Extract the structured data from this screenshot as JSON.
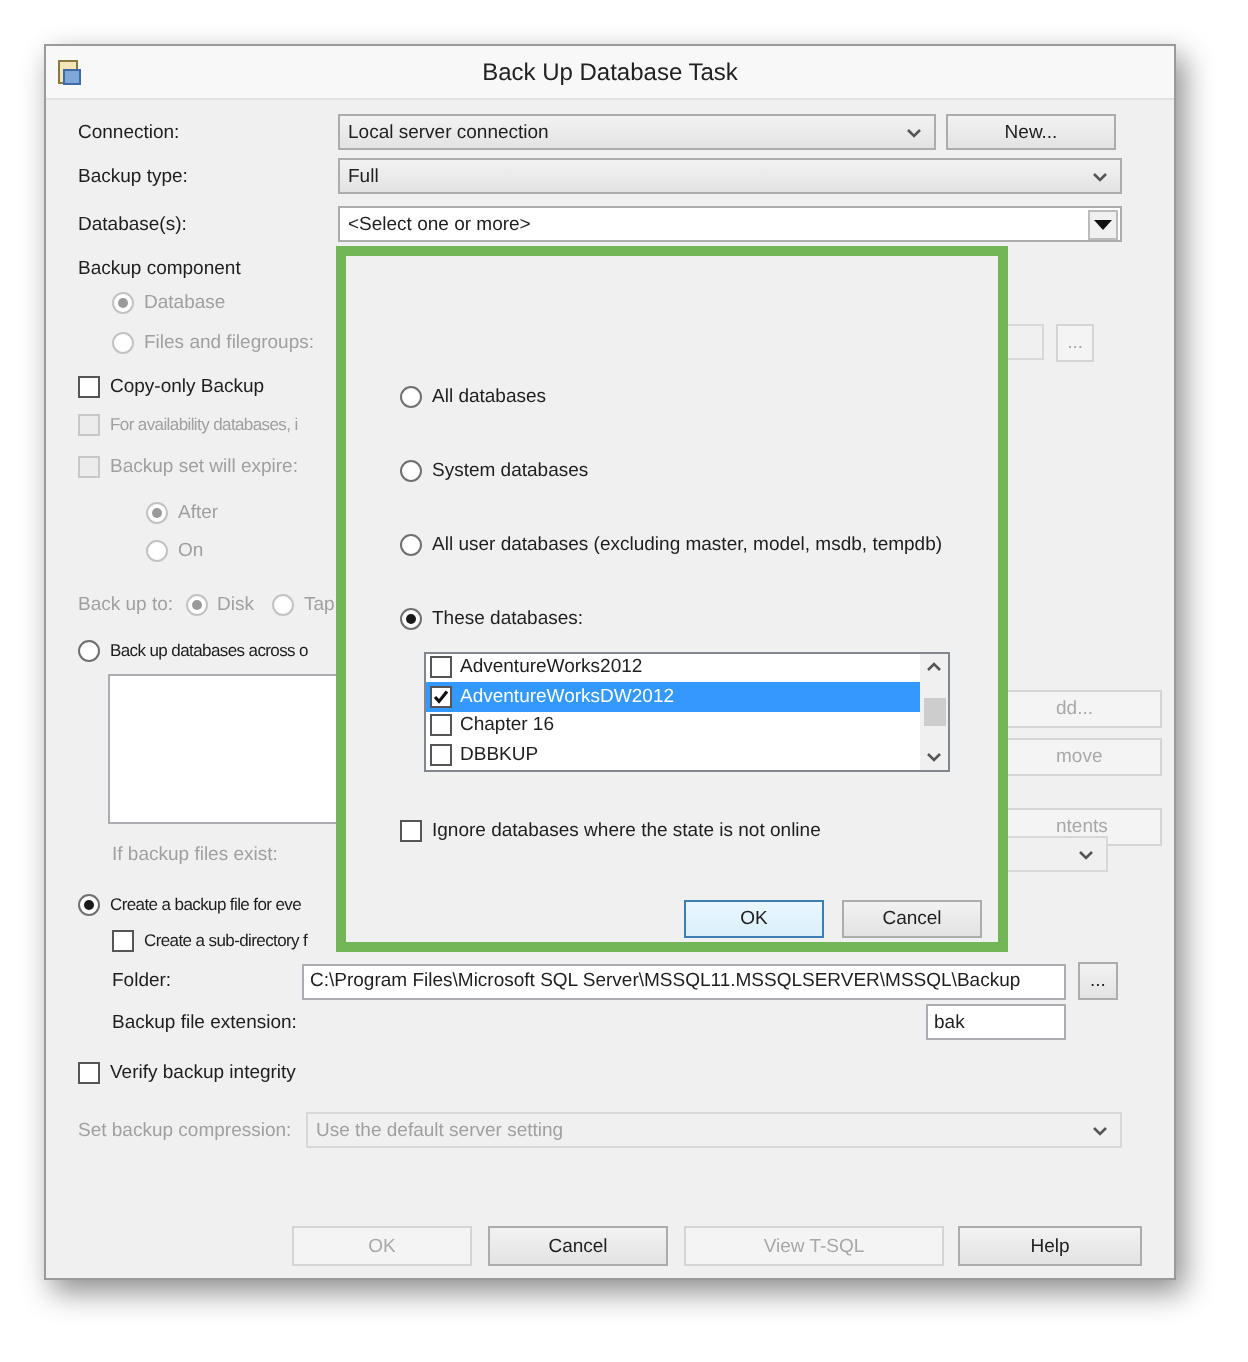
{
  "window": {
    "title": "Back Up Database Task"
  },
  "connection": {
    "label": "Connection:",
    "value": "Local server connection",
    "button": "New..."
  },
  "backup_type": {
    "label": "Backup type:",
    "value": "Full"
  },
  "databases": {
    "label": "Database(s):",
    "value": "<Select one or more>"
  },
  "backup_component": {
    "label": "Backup component",
    "browse_button": "...",
    "options": [
      {
        "label": "Database",
        "selected": true,
        "disabled": true
      },
      {
        "label": "Files and filegroups:",
        "selected": false,
        "disabled": true
      }
    ]
  },
  "options_top": [
    {
      "label": "Copy-only Backup",
      "checked": false,
      "disabled": false
    },
    {
      "label": "For availability databases, i",
      "checked": false,
      "disabled": true
    },
    {
      "label": "Backup set will expire:",
      "checked": false,
      "disabled": true
    }
  ],
  "expire_options": [
    {
      "label": "After",
      "selected": true,
      "disabled": true
    },
    {
      "label": "On",
      "selected": false,
      "disabled": true
    }
  ],
  "back_up_to": {
    "label": "Back up to:",
    "disabled": true,
    "options": [
      {
        "label": "Disk",
        "selected": true
      },
      {
        "label": "Tap",
        "selected": false
      }
    ]
  },
  "across_option": {
    "label": "Back up databases across o",
    "selected": false
  },
  "side_buttons": [
    {
      "label": "dd...",
      "disabled": true
    },
    {
      "label": "move",
      "disabled": true
    },
    {
      "label": "ntents",
      "disabled": true
    }
  ],
  "if_exists": {
    "label": "If backup files exist:",
    "disabled": true
  },
  "per_database_option": {
    "label": "Create a backup file for eve",
    "selected": true
  },
  "subdirectory": {
    "label": "Create a sub-directory f",
    "checked": false
  },
  "folder": {
    "label": "Folder:",
    "value": "C:\\Program Files\\Microsoft SQL Server\\MSSQL11.MSSQLSERVER\\MSSQL\\Backup",
    "button": "..."
  },
  "extension": {
    "label": "Backup file extension:",
    "value": "bak"
  },
  "verify": {
    "label": "Verify backup integrity",
    "checked": false
  },
  "compression": {
    "label": "Set backup compression:",
    "value": "Use the default server setting",
    "disabled": true
  },
  "buttons": [
    {
      "label": "OK",
      "disabled": true
    },
    {
      "label": "Cancel",
      "disabled": false
    },
    {
      "label": "View T-SQL",
      "disabled": true
    },
    {
      "label": "Help",
      "disabled": false
    }
  ],
  "popup": {
    "options": [
      {
        "label": "All databases",
        "selected": false
      },
      {
        "label": "System databases",
        "selected": false
      },
      {
        "label": "All user databases  (excluding master, model, msdb, tempdb)",
        "selected": false
      },
      {
        "label": "These databases:",
        "selected": true
      }
    ],
    "databases": [
      {
        "name": "AdventureWorks2012",
        "checked": false,
        "selected": false
      },
      {
        "name": "AdventureWorksDW2012",
        "checked": true,
        "selected": true
      },
      {
        "name": "Chapter 16",
        "checked": false,
        "selected": false
      },
      {
        "name": "DBBKUP",
        "checked": false,
        "selected": false
      }
    ],
    "ignore_offline": {
      "label": "Ignore databases where the state is not online",
      "checked": false
    },
    "buttons": [
      {
        "label": "OK",
        "default": true
      },
      {
        "label": "Cancel",
        "default": false
      }
    ]
  }
}
